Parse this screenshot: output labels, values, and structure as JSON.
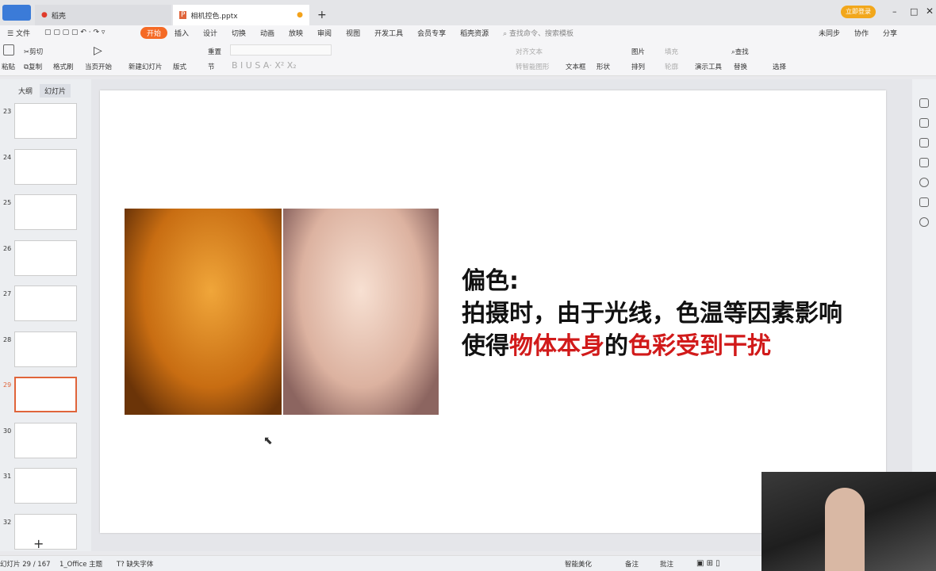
{
  "titlebar": {
    "tabs": [
      {
        "label": "稻壳"
      },
      {
        "label": "相机控色.pptx"
      }
    ],
    "new_tab": "+",
    "login_button": "立即登录"
  },
  "menu": {
    "file": "文件",
    "items": [
      "开始",
      "插入",
      "设计",
      "切换",
      "动画",
      "放映",
      "审阅",
      "视图",
      "开发工具",
      "会员专享",
      "稻壳资源"
    ],
    "search_placeholder": "查找命令、搜索模板",
    "right": [
      "未同步",
      "协作",
      "分享"
    ]
  },
  "toolbar": {
    "paste": "粘贴",
    "cut": "剪切",
    "copy": "复制",
    "format_painter": "格式刷",
    "play_from_current": "当页开始",
    "new_slide": "新建幻灯片",
    "layout": "版式",
    "section": "节",
    "reset": "重置",
    "align_text": "对齐文本",
    "smartart": "转智能图形",
    "textbox": "文本框",
    "shape": "形状",
    "picture": "图片",
    "arrange": "排列",
    "fill": "填充",
    "outline": "轮廓",
    "present_tools": "演示工具",
    "find": "查找",
    "replace": "替换",
    "select": "选择"
  },
  "left_panel": {
    "tabs": [
      "大纲",
      "幻灯片"
    ],
    "slides": [
      23,
      24,
      25,
      26,
      27,
      28,
      29,
      30,
      31,
      32
    ],
    "selected": 29,
    "add": "+"
  },
  "slide": {
    "line1": "偏色:",
    "line2": "拍摄时，由于光线，色温等因素影响",
    "line3_parts": [
      "使得",
      "物体本身",
      "的",
      "色彩受到干扰"
    ]
  },
  "status": {
    "slide_counter": "幻灯片 29 / 167",
    "theme": "1_Office 主题",
    "missing_font": "缺失字体",
    "beautify": "智能美化",
    "notes": "备注",
    "comments": "批注"
  },
  "colors": {
    "accent": "#f56a25",
    "highlight_red": "#d11a1a"
  }
}
